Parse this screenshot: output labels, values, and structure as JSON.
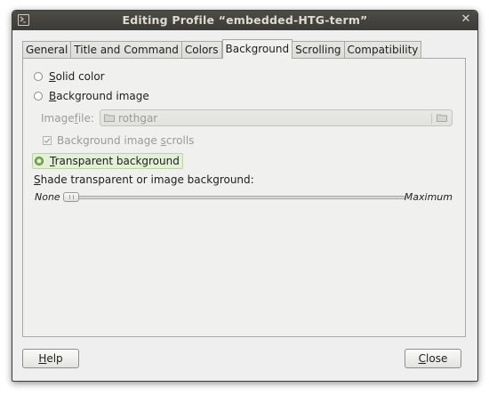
{
  "window": {
    "title": "Editing Profile “embedded-HTG-term”"
  },
  "tabs": [
    {
      "label": "General",
      "active": false
    },
    {
      "label": "Title and Command",
      "active": false
    },
    {
      "label": "Colors",
      "active": false
    },
    {
      "label": "Background",
      "active": true
    },
    {
      "label": "Scrolling",
      "active": false
    },
    {
      "label": "Compatibility",
      "active": false
    }
  ],
  "background": {
    "options": [
      {
        "first": "S",
        "rest": "olid color",
        "selected": false
      },
      {
        "first": "B",
        "rest": "ackground image",
        "selected": false
      },
      {
        "first": "T",
        "rest": "ransparent background",
        "selected": true
      }
    ],
    "image_file": {
      "label_a": "Image ",
      "label_u": "f",
      "label_b": "ile:",
      "value": "rothgar",
      "enabled": false
    },
    "scrolls": {
      "label_a": "Background image ",
      "label_u": "s",
      "label_b": "crolls",
      "checked": true,
      "enabled": false
    },
    "shade": {
      "label_a": "S",
      "label_b": "hade transparent or image background:",
      "min_label": "None",
      "max_label": "Maximum",
      "value": 0.0
    }
  },
  "buttons": {
    "help": {
      "u": "H",
      "rest": "elp"
    },
    "close": {
      "u": "C",
      "rest": "lose"
    }
  }
}
